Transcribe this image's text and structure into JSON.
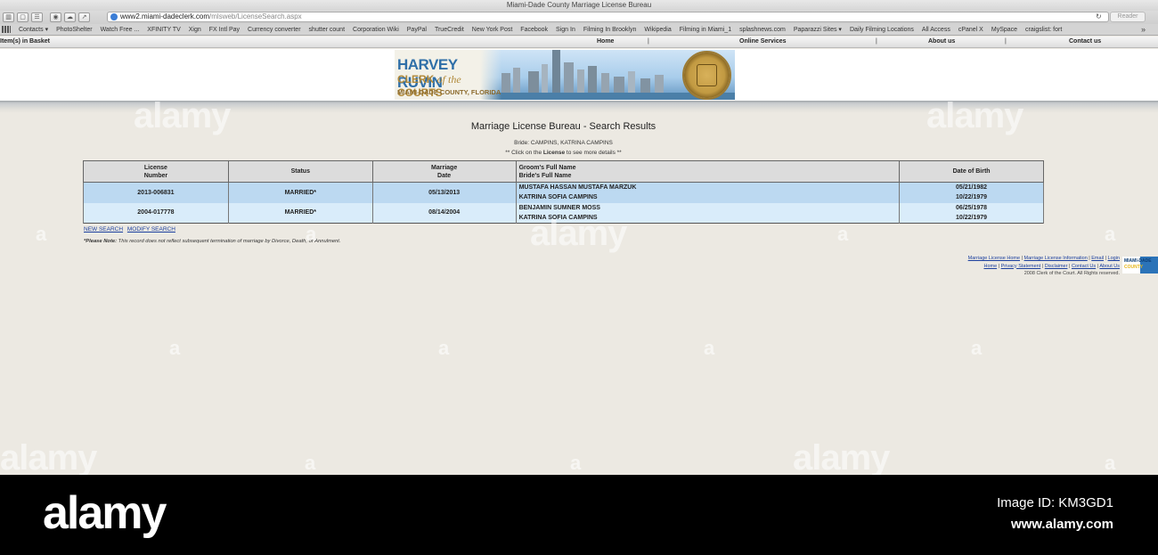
{
  "browser": {
    "window_title": "Miami-Dade County Marriage License Bureau",
    "url_host": "www2.miami-dadeclerk.com",
    "url_path": "/mlsweb/LicenseSearch.aspx",
    "reader_label": "Reader",
    "bookmarks": [
      "Contacts ▾",
      "PhotoShelter",
      "Watch Free ...",
      "XFINITY TV",
      "Xign",
      "FX Intl Pay",
      "Currency converter",
      "shutter count",
      "Corporation Wiki",
      "PayPal",
      "TrueCredit",
      "New York Post",
      "Facebook",
      "Sign In",
      "Filming In Brooklyn",
      "Wikipedia",
      "Filming in Miami_1",
      "splashnews.com",
      "Paparazzi Sites ▾",
      "Daily Filming Locations",
      "All Access",
      "cPanel X",
      "MySpace",
      "craigslist: fort"
    ]
  },
  "site_nav": {
    "basket": "Item(s) in Basket",
    "home": "Home",
    "online_services": "Online Services",
    "about_us": "About us",
    "contact_us": "Contact us"
  },
  "banner": {
    "name": "HARVEY RUVIN",
    "line2_a": "CLERK ",
    "line2_of": "of the",
    "line2_b": " COURTS",
    "line3": "MIAMI-DADE COUNTY, FLORIDA"
  },
  "content": {
    "title": "Marriage License Bureau - Search Results",
    "subtitle": "Bride: CAMPINS, KATRINA CAMPINS",
    "hint_prefix": "** Click on the ",
    "hint_bold": "License",
    "hint_suffix": " to see more details **"
  },
  "table": {
    "headers": {
      "license_1": "License",
      "license_2": "Number",
      "status": "Status",
      "date_1": "Marriage",
      "date_2": "Date",
      "groom": "Groom's Full Name",
      "bride": "Bride's Full Name",
      "dob": "Date of Birth"
    },
    "rows": [
      {
        "license": "2013-006831",
        "status": "MARRIED*",
        "date": "05/13/2013",
        "groom": "MUSTAFA HASSAN MUSTAFA MARZUK",
        "bride": "KATRINA SOFIA CAMPINS",
        "groom_dob": "05/21/1982",
        "bride_dob": "10/22/1979"
      },
      {
        "license": "2004-017778",
        "status": "MARRIED*",
        "date": "08/14/2004",
        "groom": "BENJAMIN SUMNER MOSS",
        "bride": "KATRINA SOFIA CAMPINS",
        "groom_dob": "06/25/1978",
        "bride_dob": "10/22/1979"
      }
    ]
  },
  "actions": {
    "new_search": "NEW SEARCH",
    "modify_search": "MODIFY SEARCH"
  },
  "note": {
    "label": "*Please Note:",
    "text": " This record does not reflect subsequent termination of marriage by Divorce, Death, or Annulment."
  },
  "footer": {
    "links_row1": [
      "Marriage License Home",
      "Marriage License Information",
      "Email",
      "Login"
    ],
    "links_row2": [
      "Home",
      "Privacy Statement",
      "Disclaimer",
      "Contact Us",
      "About Us"
    ],
    "copyright": "2008 Clerk of the Court. All Rights reserved.",
    "logo_line1": "MIAMI-DADE",
    "logo_line2": "COUNTY"
  },
  "watermark": {
    "logo": "alamy",
    "image_id": "Image ID: KM3GD1",
    "url": "www.alamy.com",
    "ghost": "alamy",
    "ghost_small": "a"
  }
}
